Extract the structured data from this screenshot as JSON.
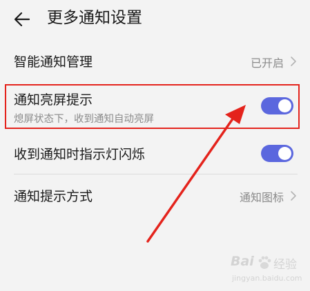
{
  "header": {
    "title": "更多通知设置"
  },
  "rows": {
    "smart": {
      "label": "智能通知管理",
      "value": "已开启"
    },
    "wake": {
      "label": "通知亮屏提示",
      "sub": "熄屏状态下，收到通知自动亮屏",
      "enabled": true
    },
    "led": {
      "label": "收到通知时指示灯闪烁",
      "enabled": true
    },
    "style": {
      "label": "通知提示方式",
      "value": "通知图标"
    }
  },
  "colors": {
    "toggle_on": "#5b67de",
    "highlight": "#e4231c",
    "background": "#f3f3f3"
  },
  "watermark": {
    "brand": "Bai",
    "brand_cn": "经验",
    "url": "jingyan.baidu.com"
  }
}
